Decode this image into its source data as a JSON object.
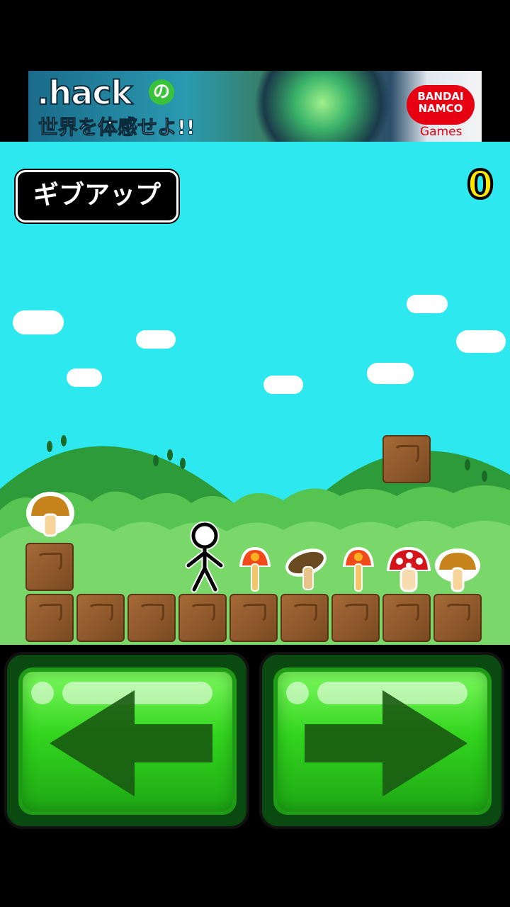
{
  "ad": {
    "title": ".hack",
    "title_suffix": "の",
    "tagline": "世界を体感せよ!!",
    "brand": "BANDAI NAMCO",
    "brand_sub": "Games"
  },
  "hud": {
    "give_up_label": "ギブアップ",
    "score": "0"
  },
  "items": [
    {
      "name": "brown-mushroom"
    },
    {
      "name": "orange-mushroom"
    },
    {
      "name": "shiitake-mushroom"
    },
    {
      "name": "orange-mushroom"
    },
    {
      "name": "red-spotted-mushroom"
    },
    {
      "name": "brown-mushroom"
    }
  ],
  "controls": {
    "left_icon": "left-arrow-icon",
    "right_icon": "right-arrow-icon"
  },
  "colors": {
    "sky": "#2ee8f0",
    "hill": "#2d9b3a",
    "bush": "#56c451",
    "block": "#8a5a2b",
    "button": "#33d51f"
  }
}
